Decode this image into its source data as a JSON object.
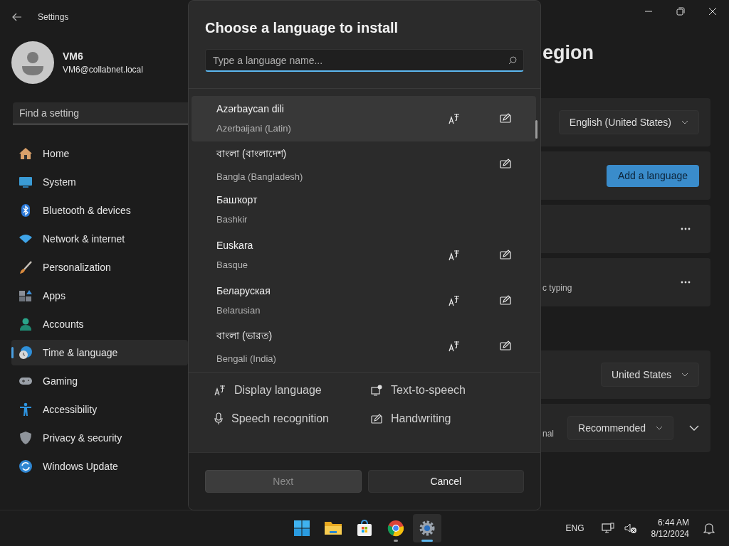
{
  "window": {
    "title": "Settings"
  },
  "account": {
    "name": "VM6",
    "email": "VM6@collabnet.local"
  },
  "search": {
    "placeholder": "Find a setting"
  },
  "sidebar": {
    "items": [
      {
        "label": "Home",
        "selected": false
      },
      {
        "label": "System",
        "selected": false
      },
      {
        "label": "Bluetooth & devices",
        "selected": false
      },
      {
        "label": "Network & internet",
        "selected": false
      },
      {
        "label": "Personalization",
        "selected": false
      },
      {
        "label": "Apps",
        "selected": false
      },
      {
        "label": "Accounts",
        "selected": false
      },
      {
        "label": "Time & language",
        "selected": true
      },
      {
        "label": "Gaming",
        "selected": false
      },
      {
        "label": "Accessibility",
        "selected": false
      },
      {
        "label": "Privacy & security",
        "selected": false
      },
      {
        "label": "Windows Update",
        "selected": false
      }
    ]
  },
  "page": {
    "title": "egion",
    "sections": [
      {
        "cards": [
          {
            "kind": "dropdown",
            "value": "English (United States)"
          },
          {
            "kind": "button",
            "label": "Add a language"
          },
          {
            "kind": "more"
          },
          {
            "kind": "more",
            "text": "c typing"
          }
        ]
      },
      {
        "cards": [
          {
            "kind": "dropdown",
            "value": "United States"
          },
          {
            "kind": "expand",
            "text": "nal",
            "value": "Recommended"
          }
        ]
      }
    ]
  },
  "dialog": {
    "title": "Choose a language to install",
    "search": {
      "placeholder": "Type a language name..."
    },
    "languages": [
      {
        "name": "Azərbaycan dili",
        "english": "Azerbaijani (Latin)",
        "hovered": true,
        "display_language": true,
        "handwriting": true
      },
      {
        "name": "বাংলা (বাংলাদেশ)",
        "english": "Bangla (Bangladesh)",
        "hovered": false,
        "display_language": false,
        "handwriting": true
      },
      {
        "name": "Башҡорт",
        "english": "Bashkir",
        "hovered": false,
        "display_language": false,
        "handwriting": false
      },
      {
        "name": "Euskara",
        "english": "Basque",
        "hovered": false,
        "display_language": true,
        "handwriting": true
      },
      {
        "name": "Беларуская",
        "english": "Belarusian",
        "hovered": false,
        "display_language": true,
        "handwriting": true
      },
      {
        "name": "বাংলা (ভারত)",
        "english": "Bengali (India)",
        "hovered": false,
        "display_language": true,
        "handwriting": true
      }
    ],
    "legend": [
      {
        "kind": "display_language",
        "label": "Display language"
      },
      {
        "kind": "text_to_speech",
        "label": "Text-to-speech"
      },
      {
        "kind": "speech_recognition",
        "label": "Speech recognition"
      },
      {
        "kind": "handwriting",
        "label": "Handwriting"
      }
    ],
    "buttons": [
      {
        "label": "Next",
        "disabled": true
      },
      {
        "label": "Cancel",
        "disabled": false
      }
    ]
  },
  "taskbar": {
    "apps": [
      {
        "selected": false,
        "running": false
      },
      {
        "selected": false,
        "running": false
      },
      {
        "selected": false,
        "running": false
      },
      {
        "selected": false,
        "running": true
      },
      {
        "selected": true,
        "running": true
      }
    ],
    "language": "ENG",
    "time": "6:44 AM",
    "date": "8/12/2024"
  }
}
